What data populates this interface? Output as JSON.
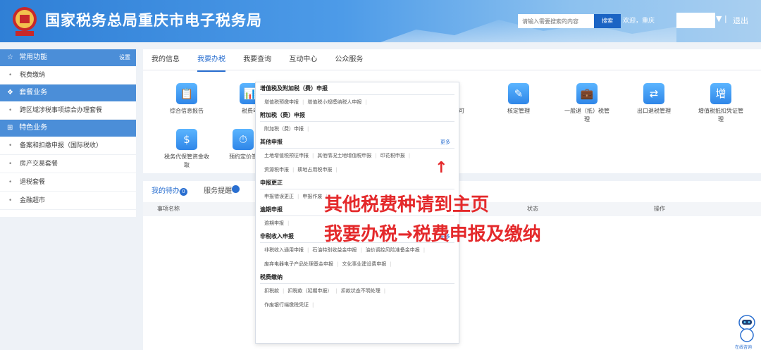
{
  "header": {
    "site_title": "国家税务总局重庆市电子税务局",
    "search_placeholder": "请输入需要搜索的内容",
    "search_button": "搜索",
    "welcome": "欢迎，重庆",
    "user_dropdown": "▼ |",
    "logout": "退出"
  },
  "sidebar": {
    "common_title": "常用功能",
    "common_settings": "设置",
    "common_items": [
      "税费缴纳"
    ],
    "package_title": "套餐业务",
    "package_items": [
      "跨区域涉税事项综合办理套餐"
    ],
    "special_title": "特色业务",
    "special_items": [
      "备案和扣缴申报（国际税收）",
      "房产交易套餐",
      "退税套餐",
      "金融超市"
    ]
  },
  "tabs": [
    "我的信息",
    "我要办税",
    "我要查询",
    "互动中心",
    "公众服务"
  ],
  "services": [
    {
      "icon": "📋",
      "label": "综合信息报告"
    },
    {
      "icon": "📊",
      "label": "税费申"
    },
    {
      "icon": "📄",
      "label": "许可"
    },
    {
      "icon": "✎",
      "label": "核定管理"
    },
    {
      "icon": "💼",
      "label": "一般退（抵）税管理"
    },
    {
      "icon": "⇄",
      "label": "出口退税管理"
    },
    {
      "icon": "增",
      "label": "增值税抵扣凭证管理"
    },
    {
      "icon": "$",
      "label": "税务代保管资金收取"
    },
    {
      "icon": "⏱",
      "label": "预约定价签"
    }
  ],
  "bottom_tabs": {
    "todo": "我的待办",
    "todo_count": "0",
    "reminder": "服务提醒"
  },
  "table_headers": [
    "事项名称",
    "状态",
    "操作"
  ],
  "menu": {
    "groups": [
      {
        "title": "增值税及附加税（费）申报",
        "more": "",
        "rows": [
          [
            "增值税预缴申报",
            "增值税小规模纳税人申报"
          ]
        ]
      },
      {
        "title": "附加税（费）申报",
        "more": "",
        "rows": [
          [
            "附加税（费）申报"
          ]
        ]
      },
      {
        "title": "其他申报",
        "more": "更多",
        "rows": [
          [
            "土地增值税预征申报",
            "其他情况土地增值税申报",
            "印花税申报"
          ],
          [
            "资源税申报",
            "耕地占用税申报"
          ]
        ]
      },
      {
        "title": "申报更正",
        "more": "",
        "rows": [
          [
            "申报错误更正",
            "申报作废"
          ]
        ]
      },
      {
        "title": "逾期申报",
        "more": "",
        "rows": [
          [
            "逾期申报"
          ]
        ]
      },
      {
        "title": "非税收入申报",
        "more": "更多",
        "rows": [
          [
            "非税收入通用申报",
            "石油特别收益金申报",
            "油价调控风险准备金申报"
          ],
          [
            "废弃电器电子产品处理基金申报",
            "文化事业建设费申报"
          ]
        ]
      },
      {
        "title": "税费缴纳",
        "more": "",
        "rows": [
          [
            "扣税款",
            "扣税款（延期申报）",
            "扣款状态不明处理"
          ],
          [
            "作废银行端缴税凭证"
          ]
        ]
      }
    ]
  },
  "annotation": {
    "line1": "其他税费种请到主页",
    "line2": "我要办税→税费申报及缴纳",
    "arrow": "↑"
  },
  "assistant_label": "在线咨询"
}
